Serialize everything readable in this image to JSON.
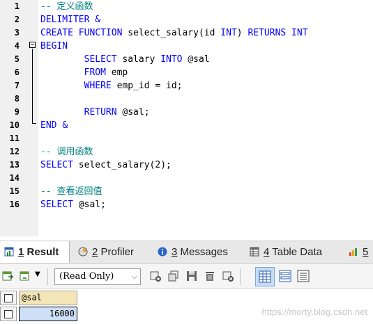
{
  "editor": {
    "lines": [
      {
        "n": "1",
        "text": "-- 定义函数",
        "type": "comment"
      },
      {
        "n": "2",
        "parts": [
          {
            "t": "DELIMITER ",
            "k": "kw"
          },
          {
            "t": "&",
            "k": "kw"
          }
        ]
      },
      {
        "n": "3",
        "parts": [
          {
            "t": "CREATE FUNCTION ",
            "k": "kw"
          },
          {
            "t": "select_salary(id ",
            "k": ""
          },
          {
            "t": "INT",
            "k": "kw"
          },
          {
            "t": ") ",
            "k": ""
          },
          {
            "t": "RETURNS INT",
            "k": "kw"
          }
        ]
      },
      {
        "n": "4",
        "parts": [
          {
            "t": "BEGIN",
            "k": "kw"
          }
        ]
      },
      {
        "n": "5",
        "parts": [
          {
            "t": "        SELECT ",
            "k": "kw"
          },
          {
            "t": "salary ",
            "k": ""
          },
          {
            "t": "INTO ",
            "k": "kw"
          },
          {
            "t": "@sal",
            "k": ""
          }
        ]
      },
      {
        "n": "6",
        "parts": [
          {
            "t": "        FROM ",
            "k": "kw"
          },
          {
            "t": "emp",
            "k": ""
          }
        ]
      },
      {
        "n": "7",
        "parts": [
          {
            "t": "        WHERE ",
            "k": "kw"
          },
          {
            "t": "emp_id = id;",
            "k": ""
          }
        ]
      },
      {
        "n": "8",
        "parts": []
      },
      {
        "n": "9",
        "parts": [
          {
            "t": "        RETURN ",
            "k": "kw"
          },
          {
            "t": "@sal;",
            "k": ""
          }
        ]
      },
      {
        "n": "10",
        "parts": [
          {
            "t": "END ",
            "k": "kw"
          },
          {
            "t": "&",
            "k": "kw"
          }
        ]
      },
      {
        "n": "11",
        "parts": []
      },
      {
        "n": "12",
        "text": "-- 调用函数",
        "type": "comment"
      },
      {
        "n": "13",
        "parts": [
          {
            "t": "SELECT ",
            "k": "kw"
          },
          {
            "t": "select_salary(2);",
            "k": ""
          }
        ]
      },
      {
        "n": "14",
        "parts": []
      },
      {
        "n": "15",
        "text": "-- 查看返回值",
        "type": "comment"
      },
      {
        "n": "16",
        "parts": [
          {
            "t": "SELECT ",
            "k": "kw"
          },
          {
            "t": "@sal;",
            "k": ""
          }
        ]
      }
    ]
  },
  "tabs": [
    {
      "num": "1",
      "label": " Result",
      "active": true,
      "icon": "result-grid-icon"
    },
    {
      "num": "2",
      "label": " Profiler",
      "active": false,
      "icon": "profiler-icon"
    },
    {
      "num": "3",
      "label": " Messages",
      "active": false,
      "icon": "info-icon"
    },
    {
      "num": "4",
      "label": " Table Data",
      "active": false,
      "icon": "table-icon"
    },
    {
      "num": "5",
      "label": "",
      "active": false,
      "icon": "info-chart-icon"
    }
  ],
  "toolbar": {
    "mode": "(Read Only)"
  },
  "grid": {
    "column": "@sal",
    "value": "16000"
  },
  "watermark": "https://morty.blog.csdn.net",
  "colors": {
    "keyword": "#0000ff",
    "comment": "#008080",
    "header": "#f2e6b6",
    "selected_cell": "#cde0f7"
  }
}
